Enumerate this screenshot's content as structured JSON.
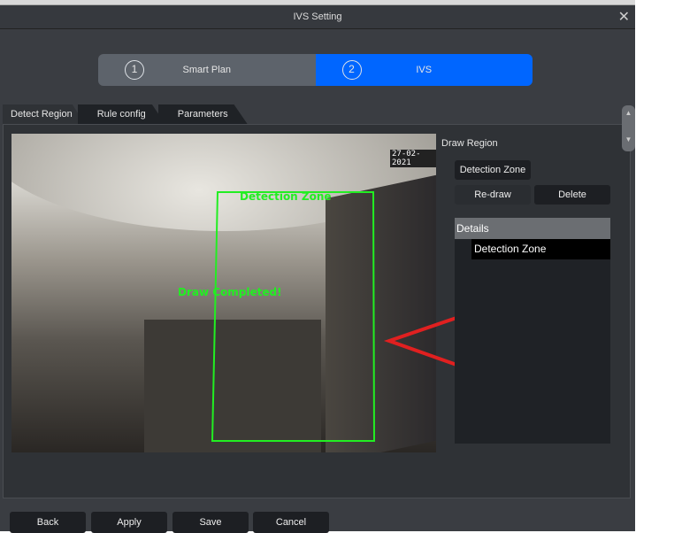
{
  "window": {
    "title": "IVS Setting",
    "close_icon": "close-icon"
  },
  "steps": [
    {
      "num": "1",
      "label": "Smart Plan"
    },
    {
      "num": "2",
      "label": "IVS"
    }
  ],
  "tabs": [
    "Detect Region",
    "Rule config",
    "Parameters"
  ],
  "video": {
    "timestamp": "27-02-2021",
    "zone_label": "Detection Zone",
    "status": "Draw Completed!"
  },
  "right": {
    "title": "Draw Region",
    "zone_button": "Detection Zone",
    "redraw": "Re-draw",
    "delete": "Delete",
    "details_header": "Details",
    "details_items": [
      "Detection Zone"
    ]
  },
  "footer": {
    "back": "Back",
    "apply": "Apply",
    "save": "Save",
    "cancel": "Cancel"
  },
  "colors": {
    "accent": "#0066ff",
    "zone": "#22ee22",
    "arrow": "#e02020"
  }
}
